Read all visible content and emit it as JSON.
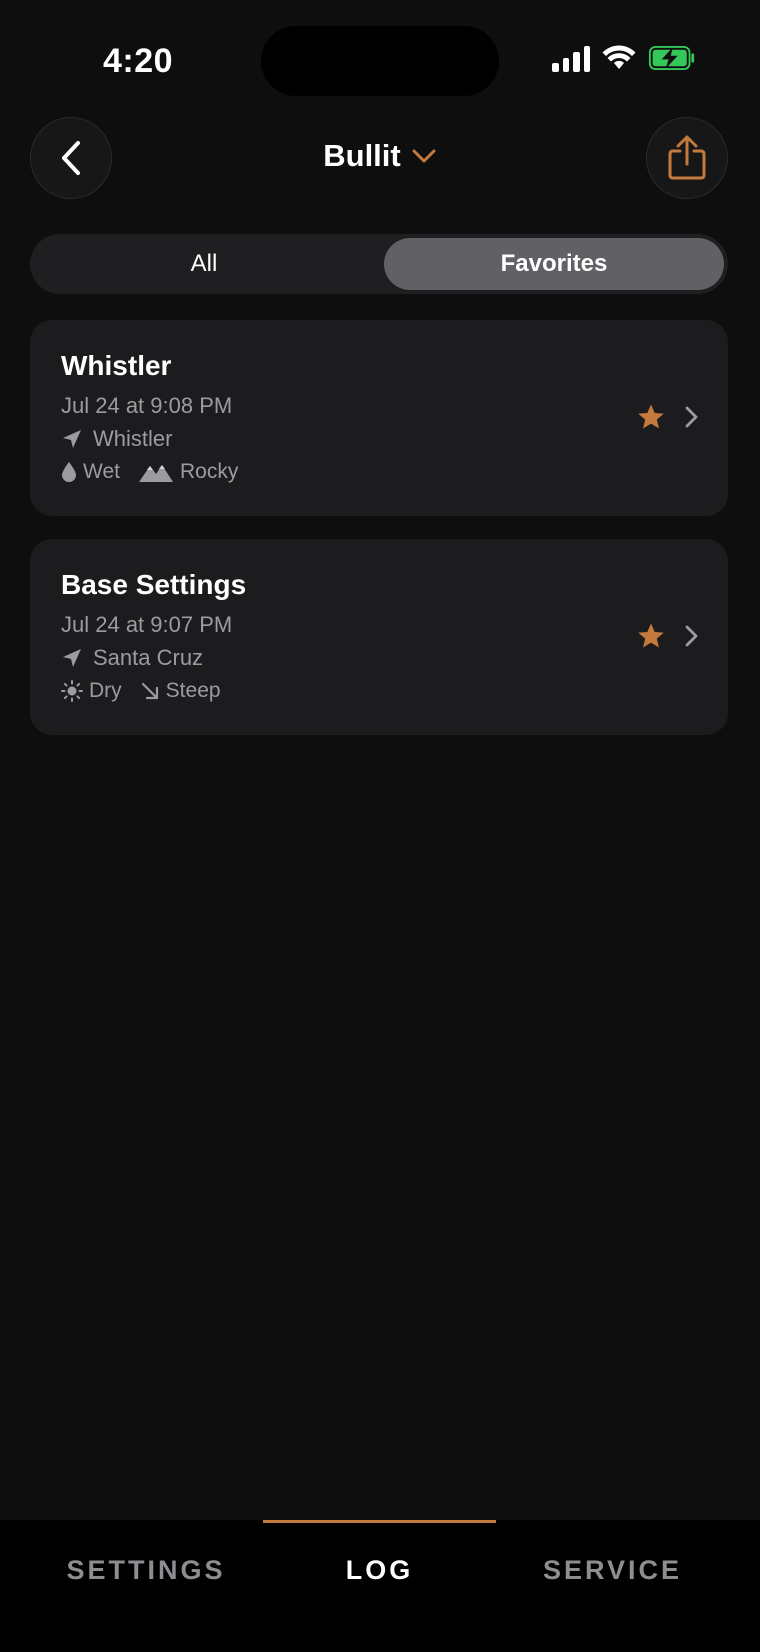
{
  "status_bar": {
    "time": "4:20"
  },
  "header": {
    "title": "Bullit"
  },
  "segments": {
    "all": "All",
    "favorites": "Favorites",
    "selected": "Favorites"
  },
  "entries": [
    {
      "title": "Whistler",
      "date": "Jul 24 at 9:08 PM",
      "location": "Whistler",
      "tags": [
        {
          "icon": "drop-icon",
          "label": "Wet"
        },
        {
          "icon": "mountains-icon",
          "label": "Rocky"
        }
      ],
      "favorite": true
    },
    {
      "title": "Base Settings",
      "date": "Jul 24 at 9:07 PM",
      "location": "Santa Cruz",
      "tags": [
        {
          "icon": "sun-icon",
          "label": "Dry"
        },
        {
          "icon": "arrow-down-right-icon",
          "label": "Steep"
        }
      ],
      "favorite": true
    }
  ],
  "tabs": {
    "settings": "SETTINGS",
    "log": "LOG",
    "service": "SERVICE",
    "active": "LOG"
  },
  "colors": {
    "accent": "#c47a3c",
    "background": "#0e0e0e",
    "card": "#1c1c1e",
    "muted_text": "#9c9c9f",
    "battery_green": "#34c759"
  }
}
